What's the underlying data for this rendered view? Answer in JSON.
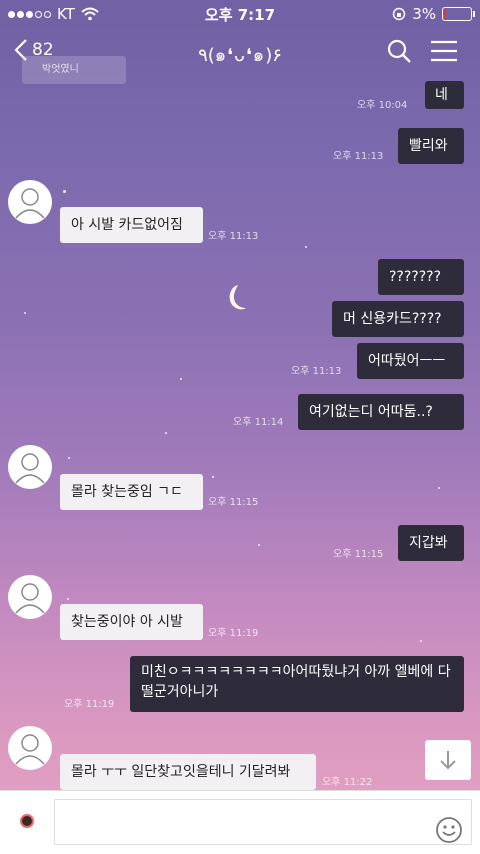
{
  "status_bar": {
    "carrier": "KT",
    "time": "오후 7:17",
    "battery_percent": "3%"
  },
  "header": {
    "back_count": "82",
    "title": "٩(๑❛ᴗ❛๑)۶",
    "system_preview": "박엇였니"
  },
  "messages": [
    {
      "side": "mine",
      "text": "네",
      "time": "오후 10:04"
    },
    {
      "side": "mine",
      "text": "빨리와",
      "time": "오후 11:13"
    },
    {
      "side": "theirs",
      "text": "아 시발 카드없어짐",
      "time": "오후 11:13"
    },
    {
      "side": "mine",
      "text": "???????",
      "time": ""
    },
    {
      "side": "mine",
      "text": "머 신용카드????",
      "time": ""
    },
    {
      "side": "mine",
      "text": "어따뒀어ㅡㅡ",
      "time": "오후 11:13"
    },
    {
      "side": "mine",
      "text": "여기없는디 어따둠..?",
      "time": "오후 11:14"
    },
    {
      "side": "theirs",
      "text": "몰라 찾는중임 ㄱㄷ",
      "time": "오후 11:15"
    },
    {
      "side": "mine",
      "text": "지갑봐",
      "time": "오후 11:15"
    },
    {
      "side": "theirs",
      "text": "찾는중이야 아 시발",
      "time": "오후 11:19"
    },
    {
      "side": "mine",
      "text": "미친ㅇㅋㅋㅋㅋㅋㅋㅋㅋ아어따뒀냐거 아까 엘베에 다 떨군거아니가",
      "time": "오후 11:19"
    },
    {
      "side": "theirs",
      "text": "몰라 ㅜㅜ 일단찾고잇을테니 기달려봐",
      "time": "오후 11:22"
    }
  ],
  "input": {
    "value": "",
    "placeholder": ""
  },
  "icons": {
    "back": "chevron-left-icon",
    "search": "search-icon",
    "menu": "hamburger-menu-icon",
    "scroll_down": "arrow-down-icon",
    "emoji": "emoji-icon",
    "hash": "#"
  },
  "colors": {
    "my_bubble": "#2e2c3a",
    "their_bubble": "#f3f0f4"
  }
}
